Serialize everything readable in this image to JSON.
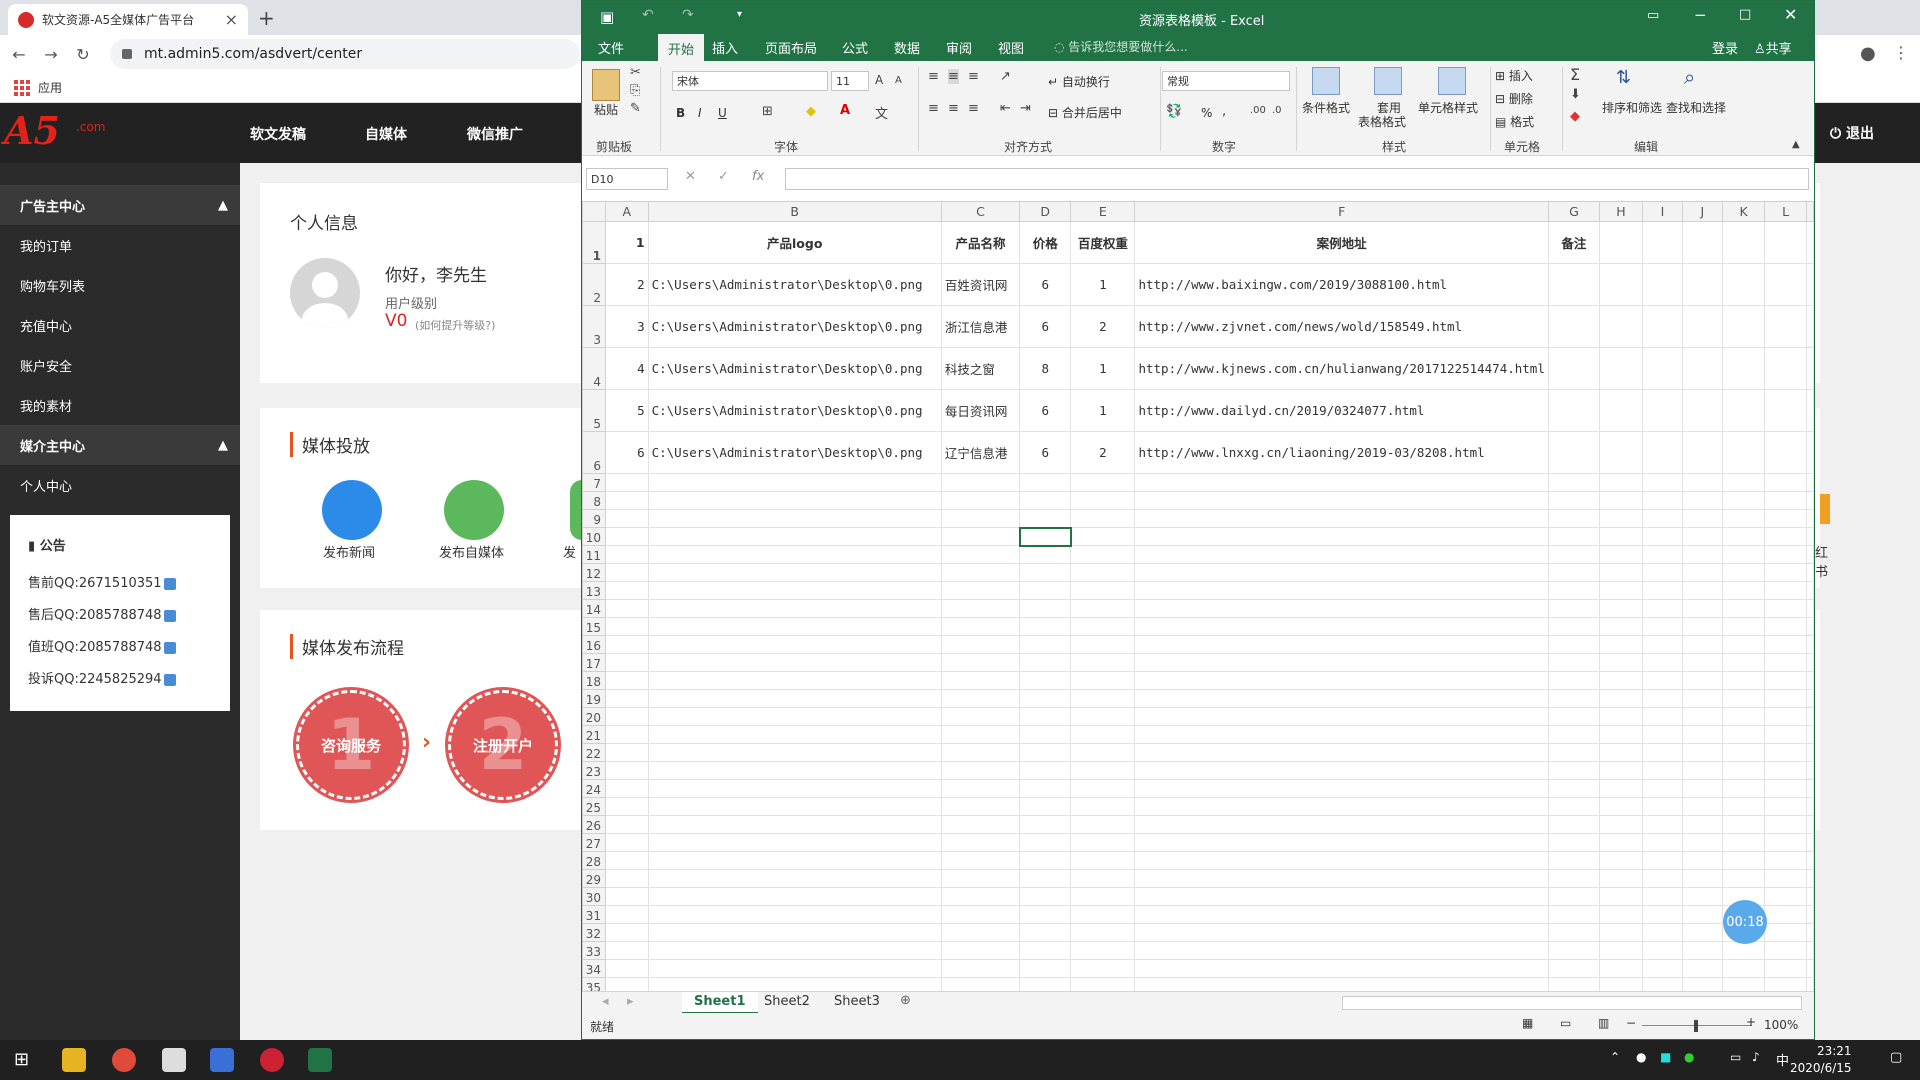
{
  "browser": {
    "tab_title": "软文资源-A5全媒体广告平台",
    "url": "mt.admin5.com/asdvert/center",
    "bookmark_apps": "应用"
  },
  "site": {
    "logo": "A5",
    "logo_sub": ".com",
    "nav": [
      "软文发稿",
      "自媒体",
      "微信推广"
    ],
    "logout": "退出",
    "sidebar": {
      "section1": "广告主中心",
      "items1": [
        "我的订单",
        "购物车列表",
        "充值中心",
        "账户安全",
        "我的素材"
      ],
      "section2": "媒介主中心",
      "items2": [
        "个人中心"
      ]
    },
    "notice": {
      "title": "公告",
      "lines": [
        "售前QQ:2671510351",
        "售后QQ:2085788748",
        "值班QQ:2085788748",
        "投诉QQ:2245825294"
      ]
    },
    "profile": {
      "title": "个人信息",
      "greeting": "你好，李先生",
      "level_label": "用户级别",
      "level": "V0",
      "level_hint": "(如何提升等级?)"
    },
    "media": {
      "title": "媒体投放",
      "buttons": [
        "发布新闻",
        "发布自媒体",
        "发"
      ],
      "right_label": "红书"
    },
    "flow": {
      "title": "媒体发布流程",
      "steps": [
        {
          "num": "1",
          "label": "咨询服务"
        },
        {
          "num": "2",
          "label": "注册开户"
        }
      ]
    }
  },
  "excel": {
    "title": "资源表格模板 - Excel",
    "tabs": [
      "文件",
      "开始",
      "插入",
      "页面布局",
      "公式",
      "数据",
      "审阅",
      "视图"
    ],
    "tell_me": "告诉我您想要做什么...",
    "login": "登录",
    "share": "共享",
    "ribbon": {
      "paste": "粘贴",
      "clipboard": "剪贴板",
      "font_name": "宋体",
      "font_size": "11",
      "font_group": "字体",
      "wrap": "自动换行",
      "merge": "合并后居中",
      "align_group": "对齐方式",
      "num_format": "常规",
      "num_group": "数字",
      "cond_format": "条件格式",
      "table_format_1": "套用",
      "table_format_2": "表格格式",
      "cell_style": "单元格样式",
      "style_group": "样式",
      "insert": "插入",
      "delete": "删除",
      "format": "格式",
      "cells_group": "单元格",
      "sort": "排序和筛选",
      "find": "查找和选择",
      "edit_group": "编辑",
      "bold": "B",
      "italic": "I",
      "underline": "U",
      "percent": "%"
    },
    "name_box": "D10",
    "fx": "fx",
    "columns": [
      "A",
      "B",
      "C",
      "D",
      "E",
      "F",
      "G",
      "H",
      "I",
      "J",
      "K",
      "L"
    ],
    "header_row": [
      "1",
      "产品logo",
      "产品名称",
      "价格",
      "百度权重",
      "案例地址",
      "备注"
    ],
    "rows": [
      [
        "2",
        "C:\\Users\\Administrator\\Desktop\\0.png",
        "百姓资讯网",
        "6",
        "1",
        "http://www.baixingw.com/2019/3088100.html"
      ],
      [
        "3",
        "C:\\Users\\Administrator\\Desktop\\0.png",
        "浙江信息港",
        "6",
        "2",
        "http://www.zjvnet.com/news/wold/158549.html"
      ],
      [
        "4",
        "C:\\Users\\Administrator\\Desktop\\0.png",
        "科技之窗",
        "8",
        "1",
        "http://www.kjnews.com.cn/hulianwang/2017122514474.html"
      ],
      [
        "5",
        "C:\\Users\\Administrator\\Desktop\\0.png",
        "每日资讯网",
        "6",
        "1",
        "http://www.dailyd.cn/2019/0324077.html"
      ],
      [
        "6",
        "C:\\Users\\Administrator\\Desktop\\0.png",
        "辽宁信息港",
        "6",
        "2",
        "http://www.lnxxg.cn/liaoning/2019-03/8208.html"
      ]
    ],
    "empty_row_start": 7,
    "empty_row_end": 35,
    "sheets": [
      "Sheet1",
      "Sheet2",
      "Sheet3"
    ],
    "status": "就绪",
    "zoom": "100%",
    "timer": "00:18"
  },
  "taskbar": {
    "time": "23:21",
    "date": "2020/6/15",
    "ime": "中"
  },
  "colors": {
    "excel_green": "#217346",
    "site_red": "#e2231a",
    "accent_orange": "#e8531f"
  }
}
